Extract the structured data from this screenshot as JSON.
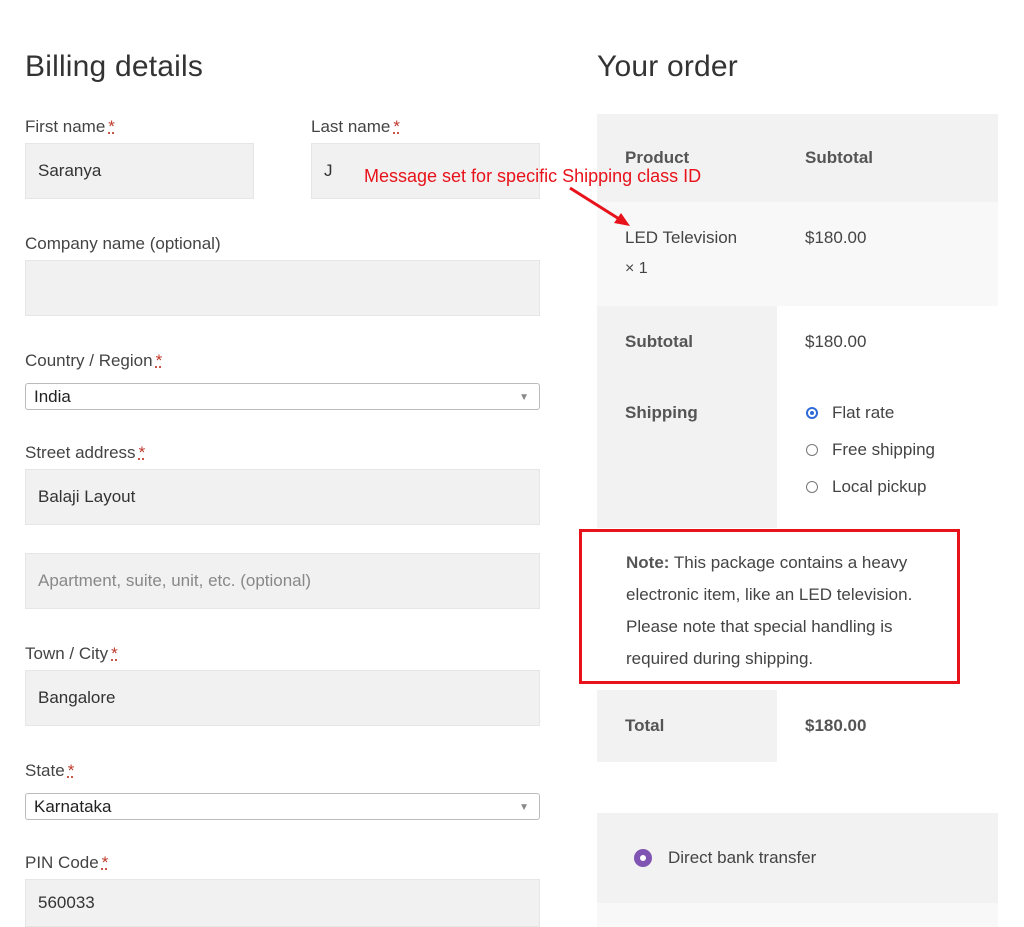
{
  "billing": {
    "title": "Billing details",
    "first_name": {
      "label": "First name",
      "value": "Saranya",
      "required_mark": "*"
    },
    "last_name": {
      "label": "Last name",
      "value": "J",
      "required_mark": "*"
    },
    "company": {
      "label": "Company name (optional)",
      "value": ""
    },
    "country": {
      "label": "Country / Region",
      "value": "India",
      "required_mark": "*"
    },
    "street": {
      "label": "Street address",
      "value": "Balaji Layout",
      "required_mark": "*"
    },
    "apartment": {
      "placeholder": "Apartment, suite, unit, etc. (optional)"
    },
    "city": {
      "label": "Town / City",
      "value": "Bangalore",
      "required_mark": "*"
    },
    "state": {
      "label": "State",
      "value": "Karnataka",
      "required_mark": "*"
    },
    "pin": {
      "label": "PIN Code",
      "value": "560033",
      "required_mark": "*"
    }
  },
  "order": {
    "title": "Your order",
    "col_product": "Product",
    "col_subtotal": "Subtotal",
    "item_name": "LED Television",
    "item_qty": "× 1",
    "item_price": "$180.00",
    "subtotal_label": "Subtotal",
    "subtotal_value": "$180.00",
    "shipping_label": "Shipping",
    "shipping_options": [
      "Flat rate",
      "Free shipping",
      "Local pickup"
    ],
    "selected_shipping": "Flat rate",
    "note_bold": "Note:",
    "note_lines": [
      " This package contains a heavy",
      "electronic item, like an LED television.",
      "Please note that special handling is",
      "required during shipping."
    ],
    "total_label": "Total",
    "total_value": "$180.00",
    "payment_method": "Direct bank transfer"
  },
  "annotation": {
    "text": "Message set for specific Shipping class ID",
    "color": "#e8121a"
  },
  "colors": {
    "accent_purple": "#7f54b3",
    "radio_blue": "#2e6bd8",
    "highlight_red": "#e8121a"
  }
}
